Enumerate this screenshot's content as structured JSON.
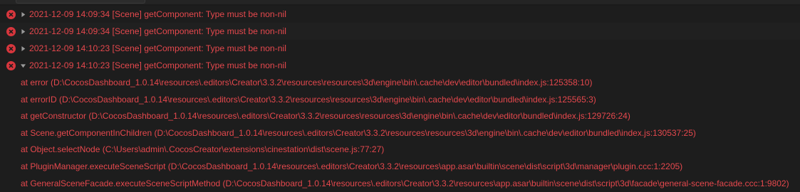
{
  "colors": {
    "background": "#1b1b1b",
    "error_text": "#e5484d",
    "error_icon": "#d8363d"
  },
  "entries": [
    {
      "label": "2021-12-09 14:09:34 [Scene] getComponent: Type must be non-nil",
      "expanded": false
    },
    {
      "label": "2021-12-09 14:09:34 [Scene] getComponent: Type must be non-nil",
      "expanded": false
    },
    {
      "label": "2021-12-09 14:10:23 [Scene] getComponent: Type must be non-nil",
      "expanded": false
    },
    {
      "label": "2021-12-09 14:10:23 [Scene] getComponent: Type must be non-nil",
      "expanded": true
    }
  ],
  "stack_trace": [
    "at error (D:\\CocosDashboard_1.0.14\\resources\\.editors\\Creator\\3.3.2\\resources\\resources\\3d\\engine\\bin\\.cache\\dev\\editor\\bundled\\index.js:125358:10)",
    "at errorID (D:\\CocosDashboard_1.0.14\\resources\\.editors\\Creator\\3.3.2\\resources\\resources\\3d\\engine\\bin\\.cache\\dev\\editor\\bundled\\index.js:125565:3)",
    "at getConstructor (D:\\CocosDashboard_1.0.14\\resources\\.editors\\Creator\\3.3.2\\resources\\resources\\3d\\engine\\bin\\.cache\\dev\\editor\\bundled\\index.js:129726:24)",
    "at Scene.getComponentInChildren (D:\\CocosDashboard_1.0.14\\resources\\.editors\\Creator\\3.3.2\\resources\\resources\\3d\\engine\\bin\\.cache\\dev\\editor\\bundled\\index.js:130537:25)",
    "at Object.selectNode (C:\\Users\\admin\\.CocosCreator\\extensions\\cinestation\\dist\\scene.js:77:27)",
    "at PluginManager.executeSceneScript (D:\\CocosDashboard_1.0.14\\resources\\.editors\\Creator\\3.3.2\\resources\\app.asar\\builtin\\scene\\dist\\script\\3d\\manager\\plugin.ccc:1:2205)",
    "at GeneralSceneFacade.executeSceneScriptMethod (D:\\CocosDashboard_1.0.14\\resources\\.editors\\Creator\\3.3.2\\resources\\app.asar\\builtin\\scene\\dist\\script\\3d\\facade\\general-scene-facade.ccc:1:9802)"
  ]
}
